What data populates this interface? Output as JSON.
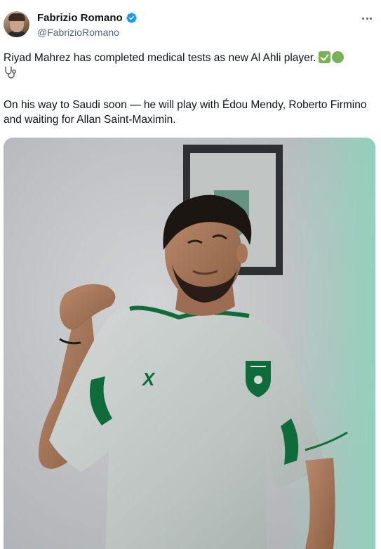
{
  "author": {
    "display_name": "Fabrizio Romano",
    "handle": "@FabrizioRomano",
    "avatar_icon": "avatar",
    "verified_icon": "verified-badge-icon",
    "verified_color": "#1d9bf0"
  },
  "tweet": {
    "line1": "Riyad Mahrez has completed medical tests as new Al Ahli player.",
    "emojis": [
      "white-check-mark-emoji",
      "green-circle-emoji",
      "stethoscope-emoji"
    ],
    "line2": "On his way to Saudi soon — he will play with Édou Mendy, Roberto Firmino and waiting for Allan Saint-Maximin."
  },
  "media": {
    "jersey_logo_text": "X",
    "colors": {
      "jersey": "#c3c9c6",
      "accent_green": "#0f6b3a",
      "background": "#c4c6c9"
    }
  },
  "menu": {
    "more_icon": "more-options-icon"
  }
}
